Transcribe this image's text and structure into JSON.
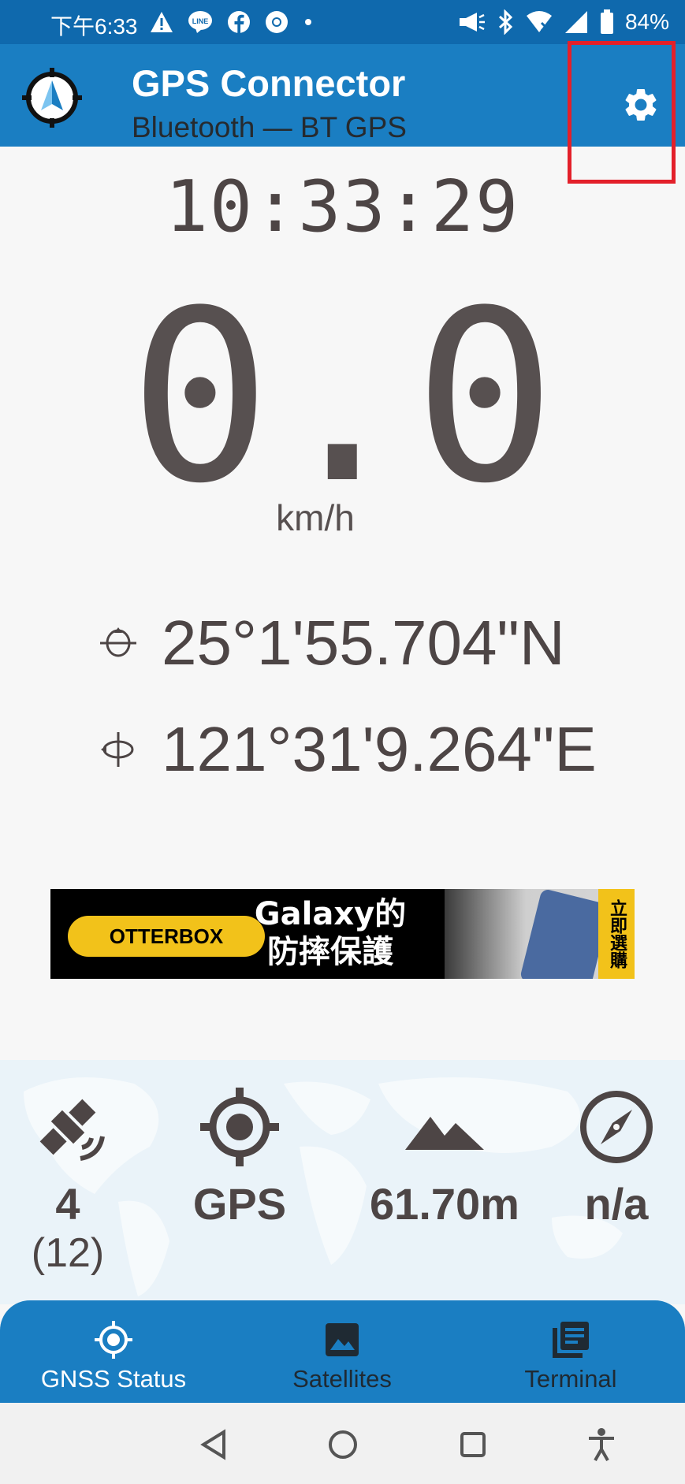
{
  "status_bar": {
    "time": "下午6:33",
    "battery": "84%",
    "icons": [
      "warning-icon",
      "line-icon",
      "facebook-icon",
      "chrome-icon",
      "dot-icon",
      "megaphone-icon",
      "bluetooth-icon",
      "wifi-icon",
      "signal-icon",
      "battery-icon"
    ]
  },
  "app_bar": {
    "title": "GPS Connector",
    "subtitle": "Bluetooth — BT GPS",
    "settings_icon": "gear-icon"
  },
  "main": {
    "clock": "10:33:29",
    "speed": "0.0",
    "speed_unit": "km/h",
    "latitude": "25°1'55.704\"N",
    "longitude": "121°31'9.264\"E"
  },
  "ad": {
    "brand": "OTTERBOX",
    "headline_line1": "Galaxy的",
    "headline_line2": "防摔保護",
    "side_tag": "立即選購"
  },
  "stats": {
    "satellites_used": "4",
    "satellites_total": "(12)",
    "fix_type": "GPS",
    "altitude": "61.70m",
    "bearing": "n/a"
  },
  "bottom_nav": {
    "items": [
      {
        "label": "GNSS Status",
        "icon": "crosshair-icon",
        "active": true
      },
      {
        "label": "Satellites",
        "icon": "image-icon",
        "active": false
      },
      {
        "label": "Terminal",
        "icon": "library-icon",
        "active": false
      }
    ]
  },
  "colors": {
    "status_bar": "#0f69ad",
    "app_bar": "#1a7ec2",
    "text_dark": "#4d4545",
    "highlight": "#e3202a"
  }
}
